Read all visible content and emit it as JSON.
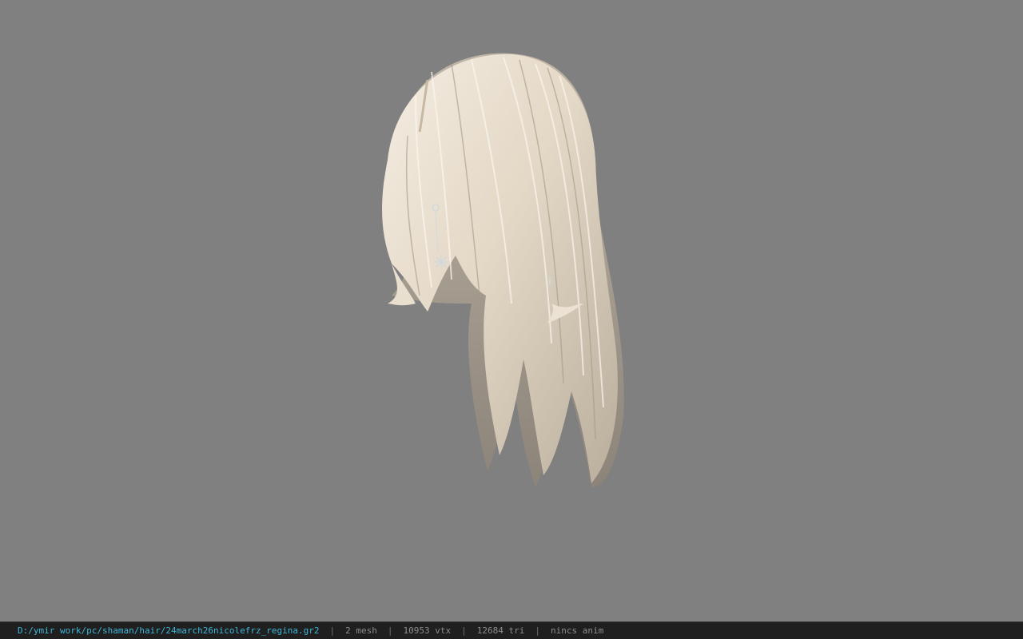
{
  "viewport": {
    "background": "#808080",
    "model_name": "hair-model",
    "model_colors": {
      "hair_light": "#efe6d8",
      "hair_mid": "#d6c8b2",
      "hair_shadow": "#9a8f80",
      "jewel": "#cfd9dc"
    }
  },
  "status_bar": {
    "file_path": "D:/ymir work/pc/shaman/hair/24march26nicolefrz_regina.gr2",
    "separator": "|",
    "mesh_count": "2 mesh",
    "vertex_count": "10953 vtx",
    "triangle_count": "12684 tri",
    "anim_status": "nincs anim",
    "path_color": "#3fb6d8",
    "text_color": "#8d8d8d"
  }
}
